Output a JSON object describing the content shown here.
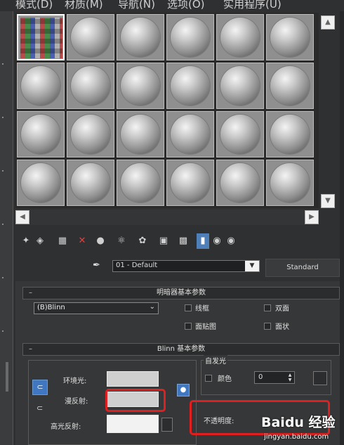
{
  "menu": {
    "items": [
      "模式(D)",
      "材质(M)",
      "导航(N)",
      "选项(O)",
      "实用程序(U)"
    ]
  },
  "slots": {
    "rows": 4,
    "cols": 6,
    "selected_index": 0
  },
  "toolbar": {
    "icons": [
      "get-material-icon",
      "put-to-scene-icon",
      "assign-material-icon",
      "reset-icon",
      "make-unique-icon",
      "put-library-icon",
      "material-id-icon",
      "show-map-icon",
      "show-end-result-icon",
      "go-to-parent-icon",
      "go-forward-icon",
      "options-icon"
    ]
  },
  "material": {
    "name": "01 - Default",
    "type": "Standard"
  },
  "shader_rollout": {
    "title": "明暗器基本参数",
    "shader": "(B)Blinn",
    "options": [
      "线框",
      "双面",
      "面贴图",
      "面状"
    ]
  },
  "blinn_rollout": {
    "title": "Blinn 基本参数",
    "ambient_label": "环境光:",
    "diffuse_label": "漫反射:",
    "specular_label": "高光反射:",
    "self_illum_title": "自发光",
    "color_label": "颜色",
    "color_value": "0",
    "opacity_label": "不透明度:"
  },
  "watermark": {
    "logo": "Baidu 经验",
    "url": "jingyan.baidu.com"
  },
  "colors": {
    "accent_blue": "#3f78c0",
    "highlight_red": "#e02020",
    "panel_bg": "#363738"
  }
}
